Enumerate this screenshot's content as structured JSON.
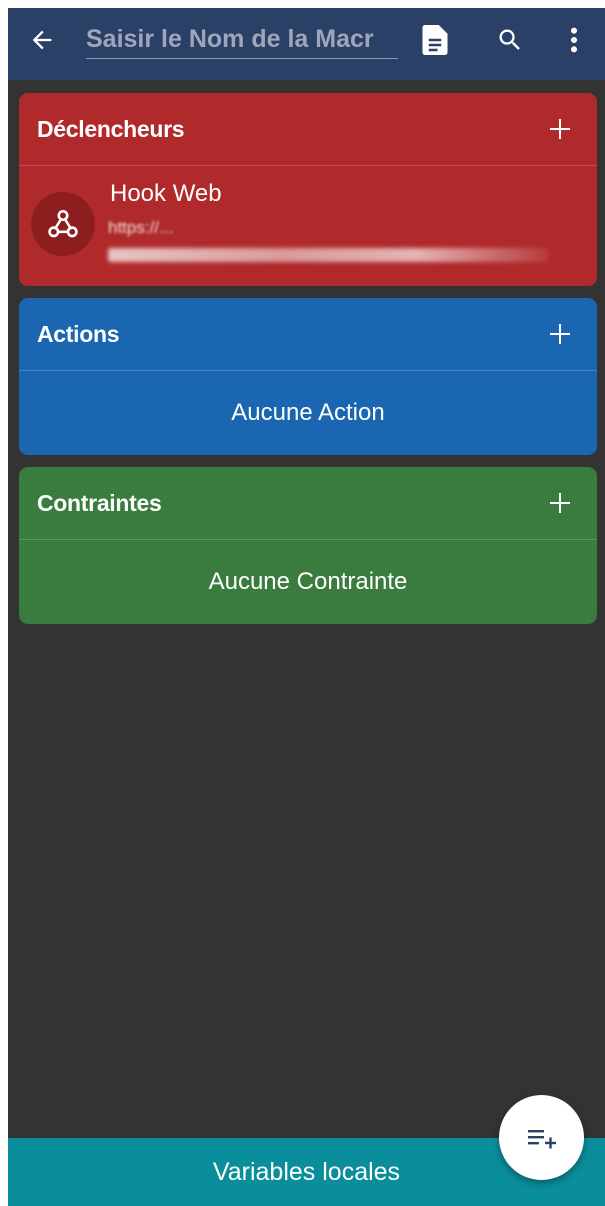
{
  "appbar": {
    "name_placeholder": "Saisir le Nom de la Macr"
  },
  "triggers": {
    "title": "Déclencheurs",
    "items": [
      {
        "title": "Hook Web",
        "detail": "https://..."
      }
    ]
  },
  "actions": {
    "title": "Actions",
    "empty_label": "Aucune Action"
  },
  "constraints": {
    "title": "Contraintes",
    "empty_label": "Aucune Contrainte"
  },
  "bottom_bar": {
    "label": "Variables locales"
  },
  "colors": {
    "appbar": "#2a4067",
    "triggers": "#b02a2b",
    "actions": "#1a66b1",
    "constraints": "#3a7c3d",
    "bottom_bar": "#0b8e9b",
    "background": "#333333"
  }
}
